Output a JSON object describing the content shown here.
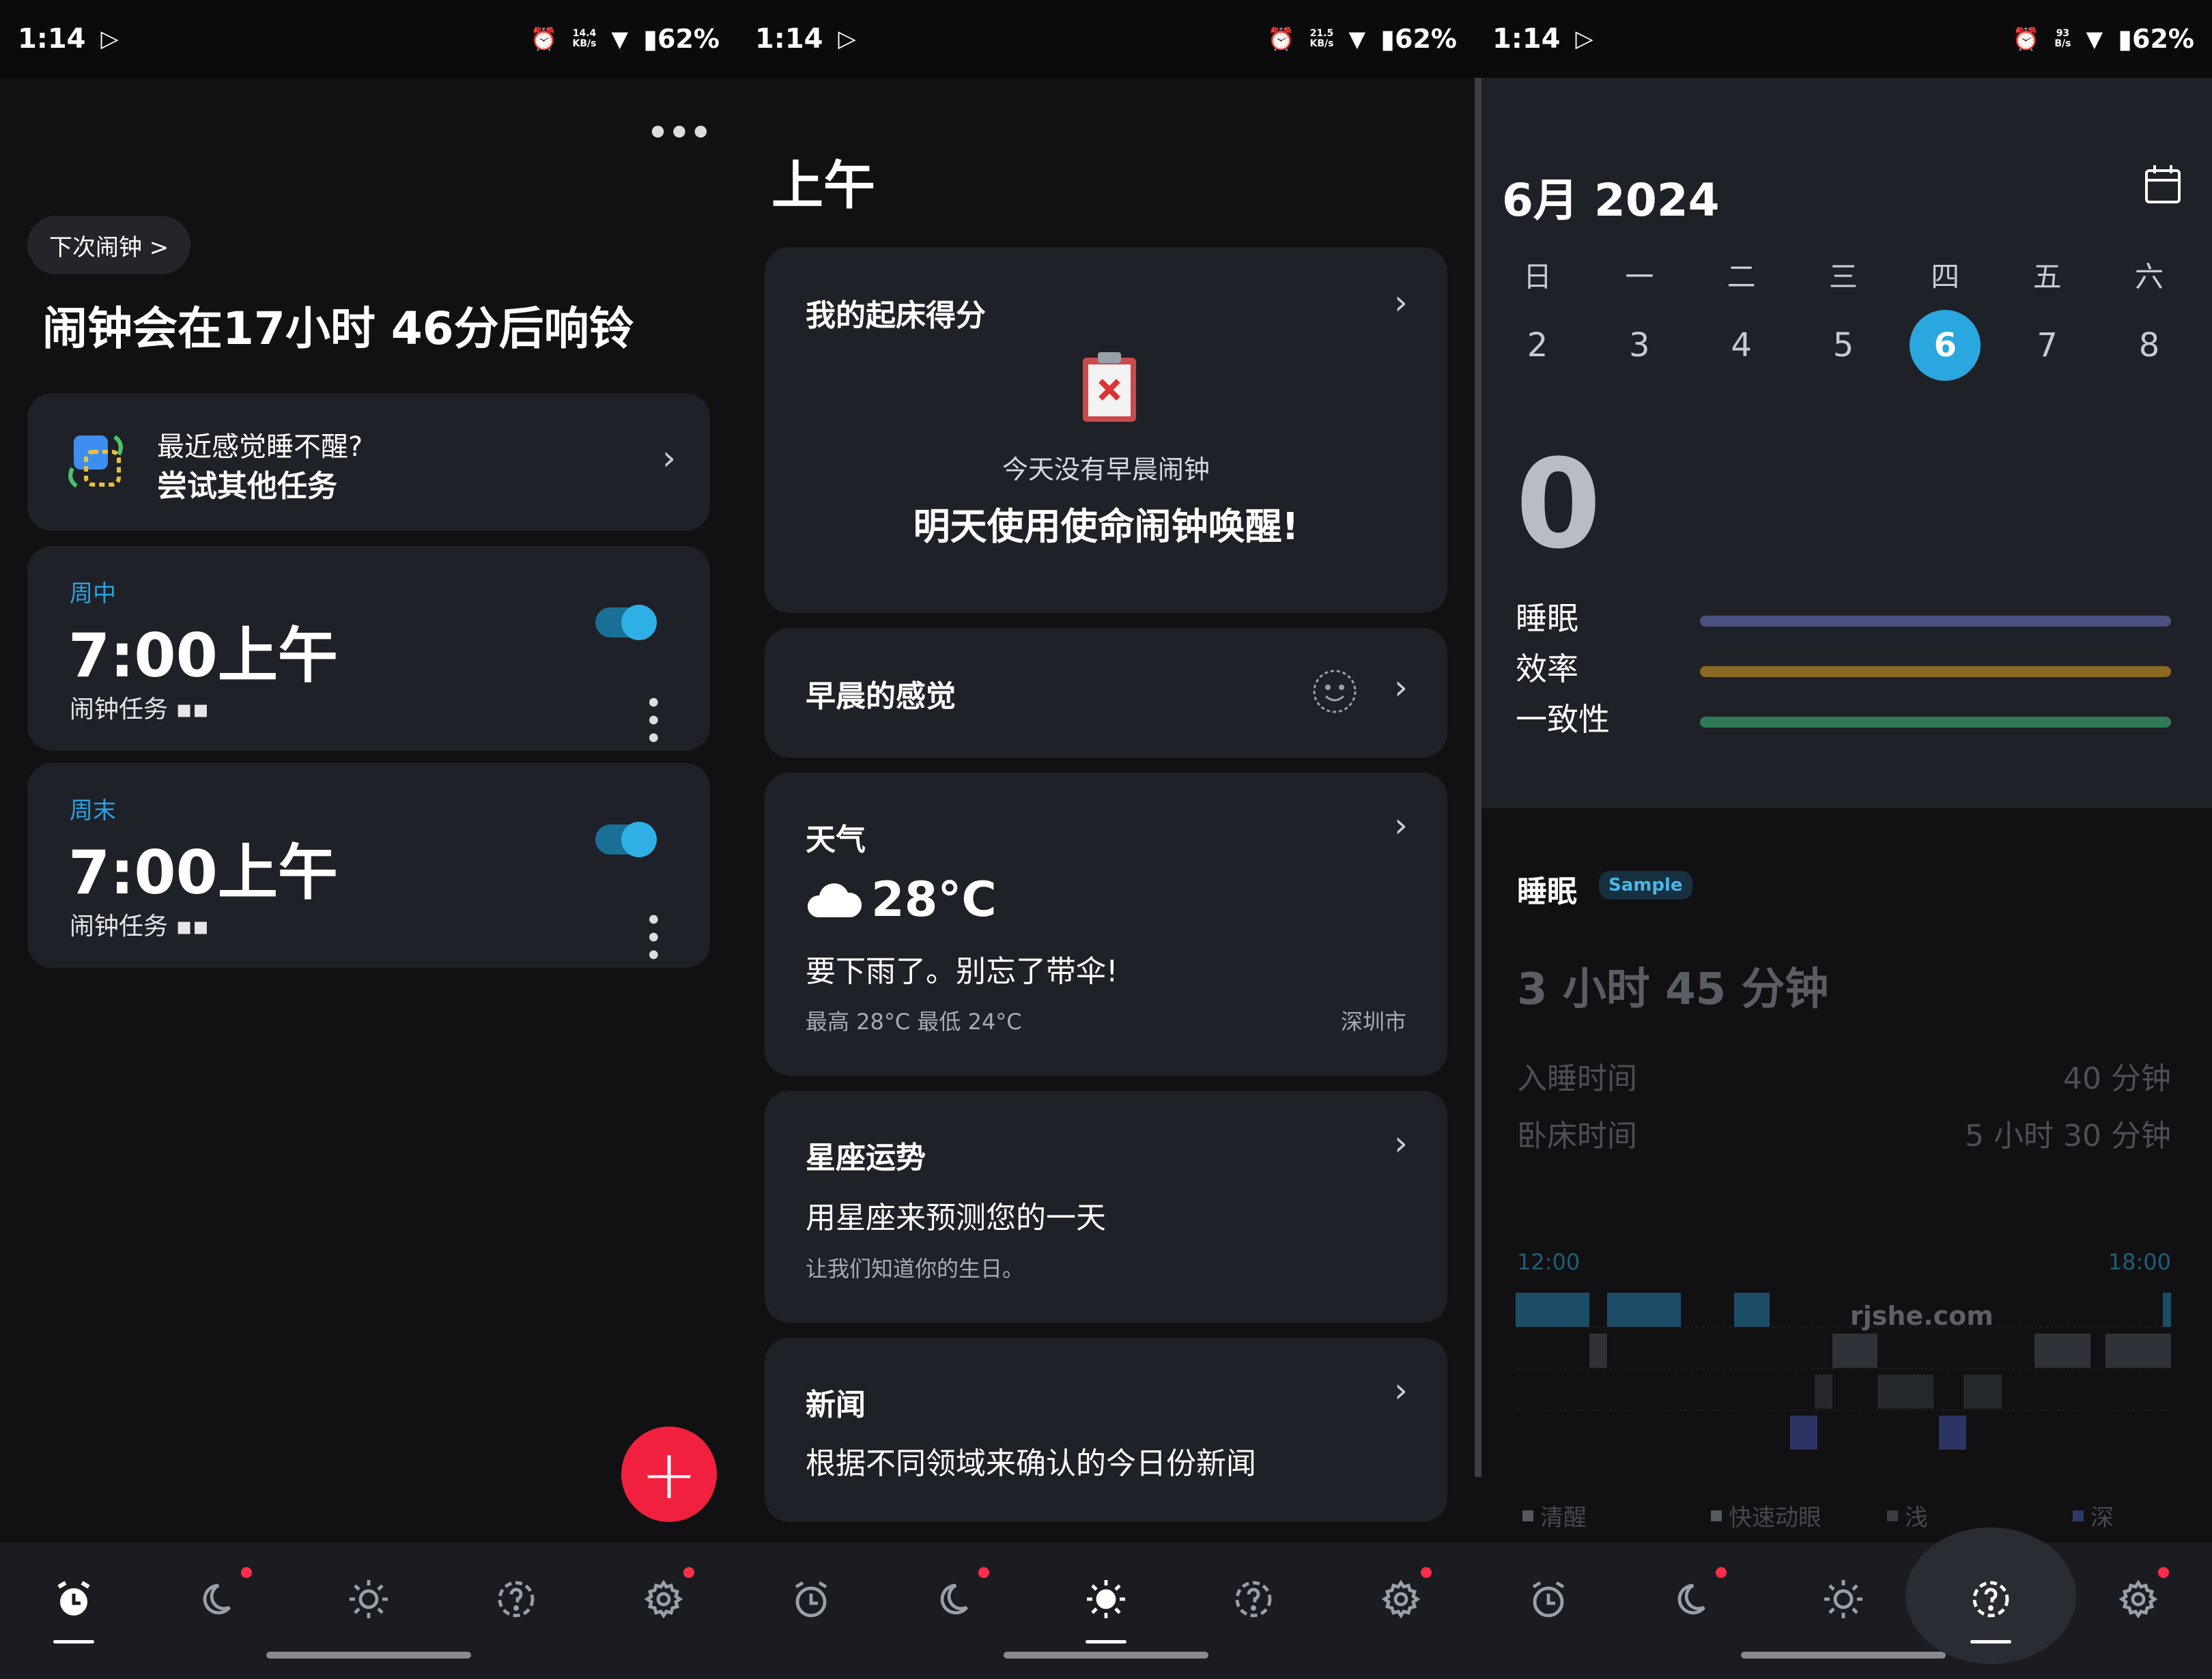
{
  "status_bar": [
    {
      "time": "1:14",
      "net_top": "14.4",
      "net_bottom": "KB/s",
      "battery": "62%"
    },
    {
      "time": "1:14",
      "net_top": "21.5",
      "net_bottom": "KB/s",
      "battery": "62%"
    },
    {
      "time": "1:14",
      "net_top": "93",
      "net_bottom": "B/s",
      "battery": "62%"
    }
  ],
  "alarm_screen": {
    "next_alarm_pill": "下次闹钟 >",
    "headline": "闹钟会在17小时 46分后响铃",
    "tip": {
      "line1": "最近感觉睡不醒?",
      "line2": "尝试其他任务"
    },
    "alarms": [
      {
        "label": "周中",
        "time": "7:00上午",
        "task": "闹钟任务",
        "enabled": true
      },
      {
        "label": "周末",
        "time": "7:00上午",
        "task": "闹钟任务",
        "enabled": true
      }
    ],
    "fab_label": "+"
  },
  "morning_screen": {
    "title": "上午",
    "wakeup_card": {
      "title": "我的起床得分",
      "subtitle": "今天没有早晨闹钟",
      "message": "明天使用使命闹钟唤醒!"
    },
    "feeling_card": {
      "title": "早晨的感觉"
    },
    "weather_card": {
      "title": "天气",
      "temp": "28°C",
      "desc": "要下雨了。别忘了带伞!",
      "range": "最高 28°C 最低 24°C",
      "city": "深圳市"
    },
    "horoscope_card": {
      "title": "星座运势",
      "line": "用星座来预测您的一天",
      "small": "让我们知道你的生日。"
    },
    "news_card": {
      "title": "新闻",
      "line": "根据不同领域来确认的今日份新闻"
    }
  },
  "report_screen": {
    "month": "6月 2024",
    "weekdays": [
      "日",
      "一",
      "二",
      "三",
      "四",
      "五",
      "六"
    ],
    "dates": [
      "2",
      "3",
      "4",
      "5",
      "6",
      "7",
      "8"
    ],
    "selected_date": "6",
    "score": "0",
    "metrics": [
      {
        "label": "睡眠",
        "color": "#4b5280"
      },
      {
        "label": "效率",
        "color": "#8a6a22"
      },
      {
        "label": "一致性",
        "color": "#2f7a55"
      }
    ],
    "sleep_title": "睡眠",
    "sample_badge": "Sample",
    "sleep_duration": "3 小时 45 分钟",
    "stats": [
      {
        "label": "入睡时间",
        "value": "40 分钟"
      },
      {
        "label": "卧床时间",
        "value": "5 小时 30 分钟"
      }
    ],
    "axis_start": "12:00",
    "axis_end": "18:00",
    "watermark": "rjshe.com",
    "legend": [
      {
        "label": "清醒",
        "color": "#555961"
      },
      {
        "label": "快速动眼",
        "color": "#555961"
      },
      {
        "label": "浅",
        "color": "#3a3d44"
      },
      {
        "label": "深",
        "color": "#2e3a6a"
      }
    ]
  },
  "colors": {
    "accent": "#2aa7df",
    "fab": "#f2203f",
    "card": "#1f2128",
    "background": "#111113"
  }
}
